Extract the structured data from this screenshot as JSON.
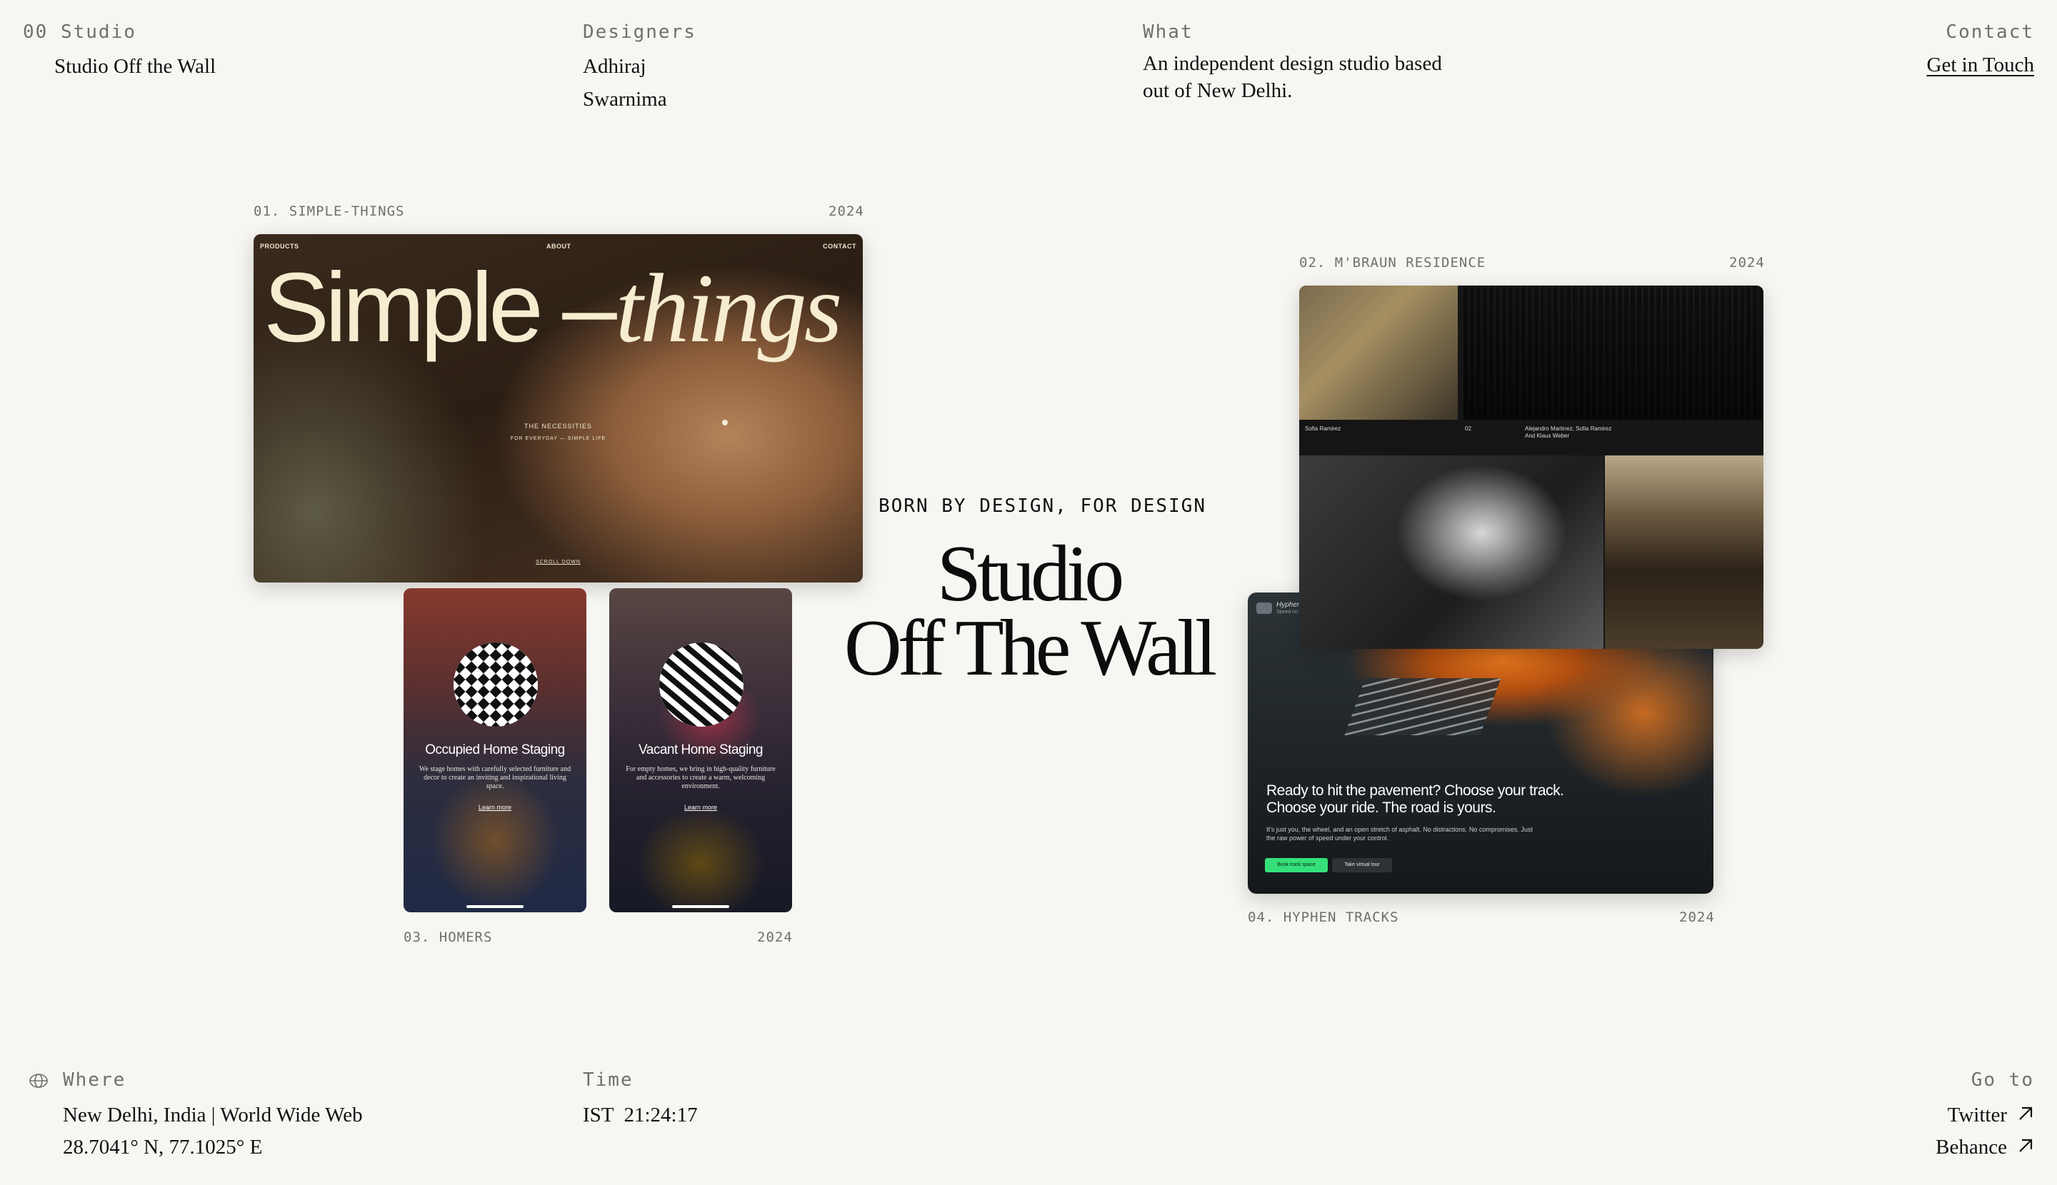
{
  "header": {
    "studio": {
      "label": "00 Studio",
      "value": "Studio Off the Wall"
    },
    "designers": {
      "label": "Designers",
      "names": [
        "Adhiraj",
        "Swarnima"
      ]
    },
    "what": {
      "label": "What",
      "line1": "An independent design studio based",
      "line2": "out of New Delhi."
    },
    "contact": {
      "label": "Contact",
      "link": "Get in Touch"
    }
  },
  "hero": {
    "tagline": "BORN BY DESIGN, FOR DESIGN",
    "title_line1": "Studio",
    "title_line2": "Off The Wall"
  },
  "projects": {
    "p1": {
      "caption": "01. SIMPLE-THINGS",
      "year": "2024",
      "nav": [
        "PRODUCTS",
        "ABOUT",
        "CONTACT"
      ],
      "title_a": "Simple –",
      "title_b": "things",
      "tag1": "THE    NECESSITIES",
      "tag2": "FOR    EVERYDAY   —   SIMPLE    LIFE",
      "scroll": "SCROLL DOWN"
    },
    "p2": {
      "caption": "02. M'BRAUN RESIDENCE",
      "year": "2024",
      "credit1": "Sofia Ramirez",
      "credit2": "02",
      "credit3": "Alejandro Martinez, Sofia Ramirez",
      "credit4": "And Klaus Weber"
    },
    "p3": {
      "caption": "03. HOMERS",
      "year": "2024",
      "phone1": {
        "title": "Occupied Home Staging",
        "desc": "We stage homes with carefully selected furniture and decor to create an inviting and inspirational living space.",
        "link": "Learn more"
      },
      "phone2": {
        "title": "Vacant Home Staging",
        "desc": "For empty homes, we bring in high-quality furniture and accessories to create a warm, welcoming environment.",
        "link": "Learn more"
      }
    },
    "p4": {
      "caption": "04. HYPHEN TRACKS",
      "year": "2024",
      "brand": "Hyphen",
      "brand_sub": "Speed on",
      "headline": "Ready to hit the pavement? Choose your track. Choose your ride. The road is yours.",
      "sub": "It's just you, the wheel, and an open stretch of asphalt. No distractions. No compromises. Just the raw power of speed under your control.",
      "btn1": "Book track space",
      "btn2": "Take virtual tour"
    }
  },
  "footer": {
    "where": {
      "label": "Where",
      "line1": "New Delhi, India | World Wide Web",
      "line2": "28.7041° N, 77.1025° E"
    },
    "time": {
      "label": "Time",
      "value": "IST  21:24:17"
    },
    "goto": {
      "label": "Go to",
      "links": [
        "Twitter",
        "Behance"
      ]
    }
  },
  "icons": {
    "globe": "globe-icon",
    "arrow": "arrow-up-right-icon"
  },
  "colors": {
    "background": "#f7f6f2",
    "text": "#111111",
    "muted": "#6f6f6b"
  }
}
